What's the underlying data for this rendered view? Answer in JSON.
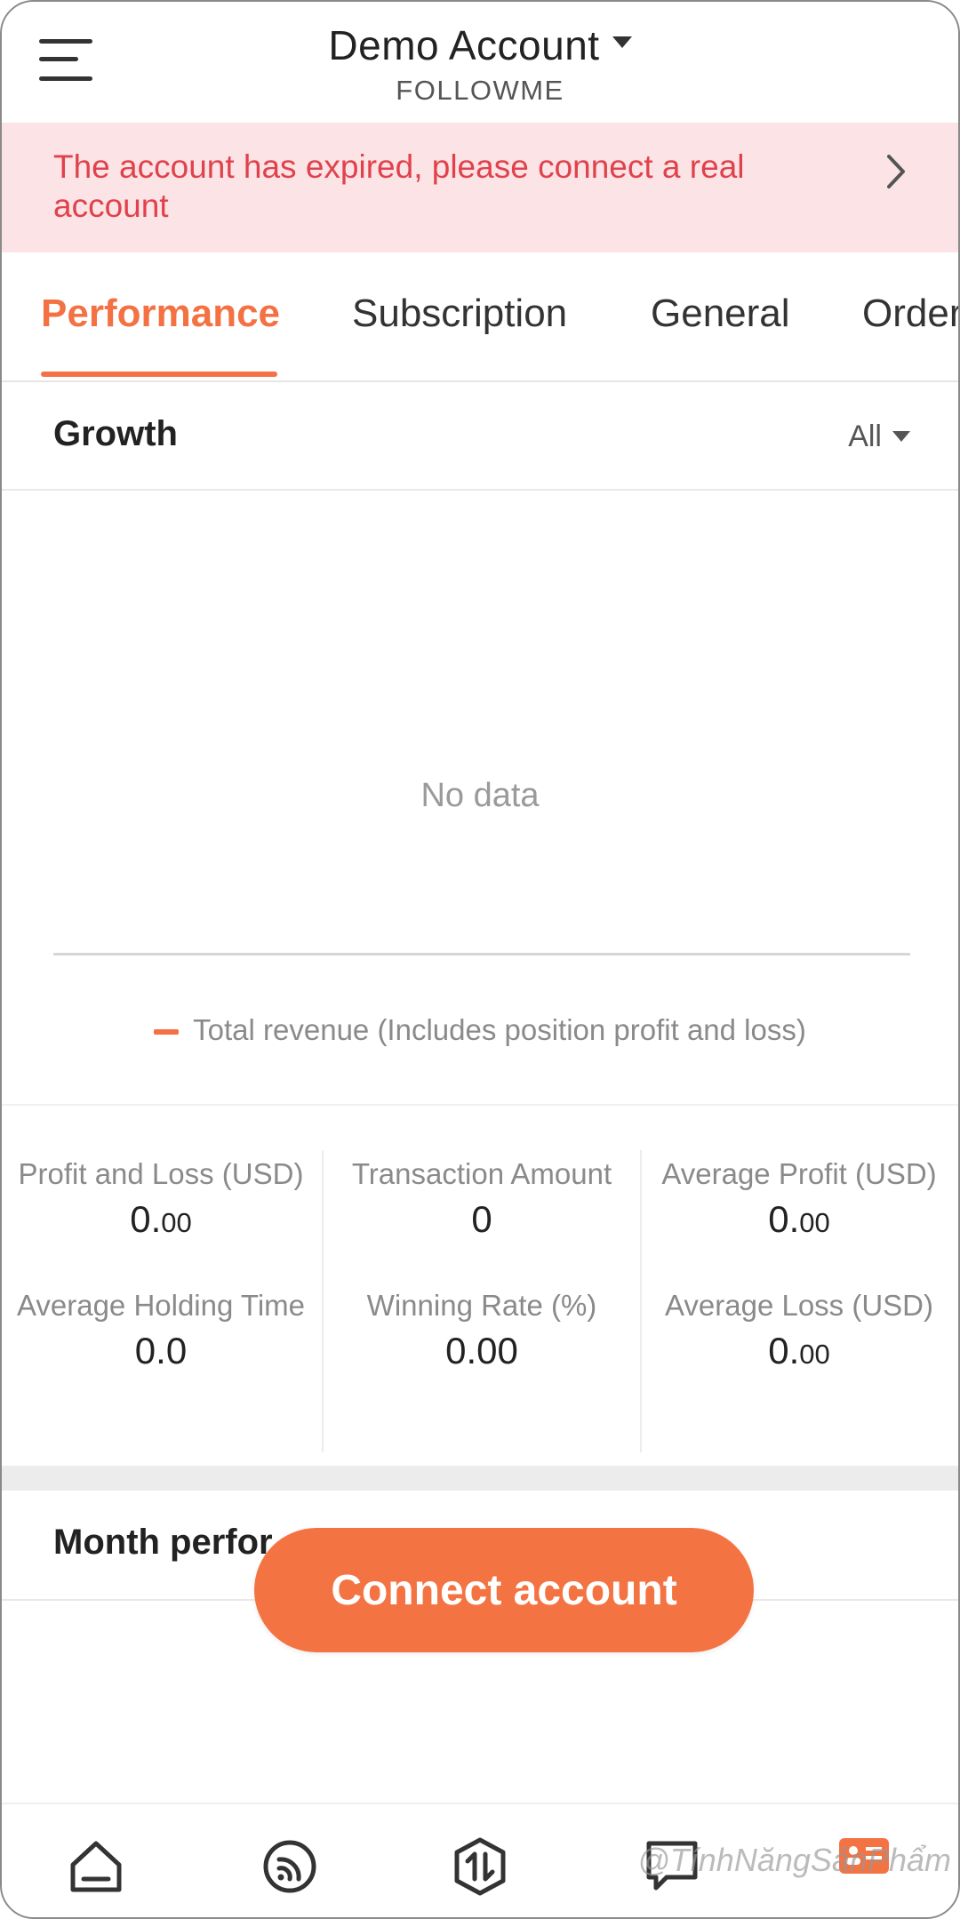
{
  "header": {
    "account_title": "Demo Account",
    "account_subtitle": "FOLLOWME"
  },
  "banner": {
    "message": "The account has expired, please connect a real account"
  },
  "tabs": [
    {
      "label": "Performance",
      "active": true
    },
    {
      "label": "Subscription",
      "active": false
    },
    {
      "label": "General",
      "active": false
    },
    {
      "label": "Order",
      "active": false
    }
  ],
  "growth": {
    "title": "Growth",
    "filter_value": "All",
    "empty_text": "No data",
    "legend_label": "Total revenue (Includes position profit and loss)"
  },
  "stats": {
    "profit_loss": {
      "label": "Profit and Loss (USD)",
      "int": "0.",
      "dec": "00"
    },
    "transaction_amount": {
      "label": "Transaction Amount",
      "value": "0"
    },
    "average_profit": {
      "label": "Average Profit (USD)",
      "int": "0.",
      "dec": "00"
    },
    "average_holding_time": {
      "label": "Average Holding Time",
      "value": "0.0"
    },
    "winning_rate": {
      "label": "Winning Rate (%)",
      "value": "0.00"
    },
    "average_loss": {
      "label": "Average Loss (USD)",
      "int": "0.",
      "dec": "00"
    }
  },
  "month": {
    "title": "Month perfor"
  },
  "cta": {
    "label": "Connect account"
  },
  "bottom_nav": {
    "icons": [
      "home-icon",
      "feed-icon",
      "trade-icon",
      "chat-icon",
      "profile-icon"
    ],
    "watermark": "@TínhNăngSảnPhẩm"
  },
  "colors": {
    "accent": "#f37142",
    "banner_bg": "#fce4e6",
    "banner_text": "#e0424c"
  }
}
